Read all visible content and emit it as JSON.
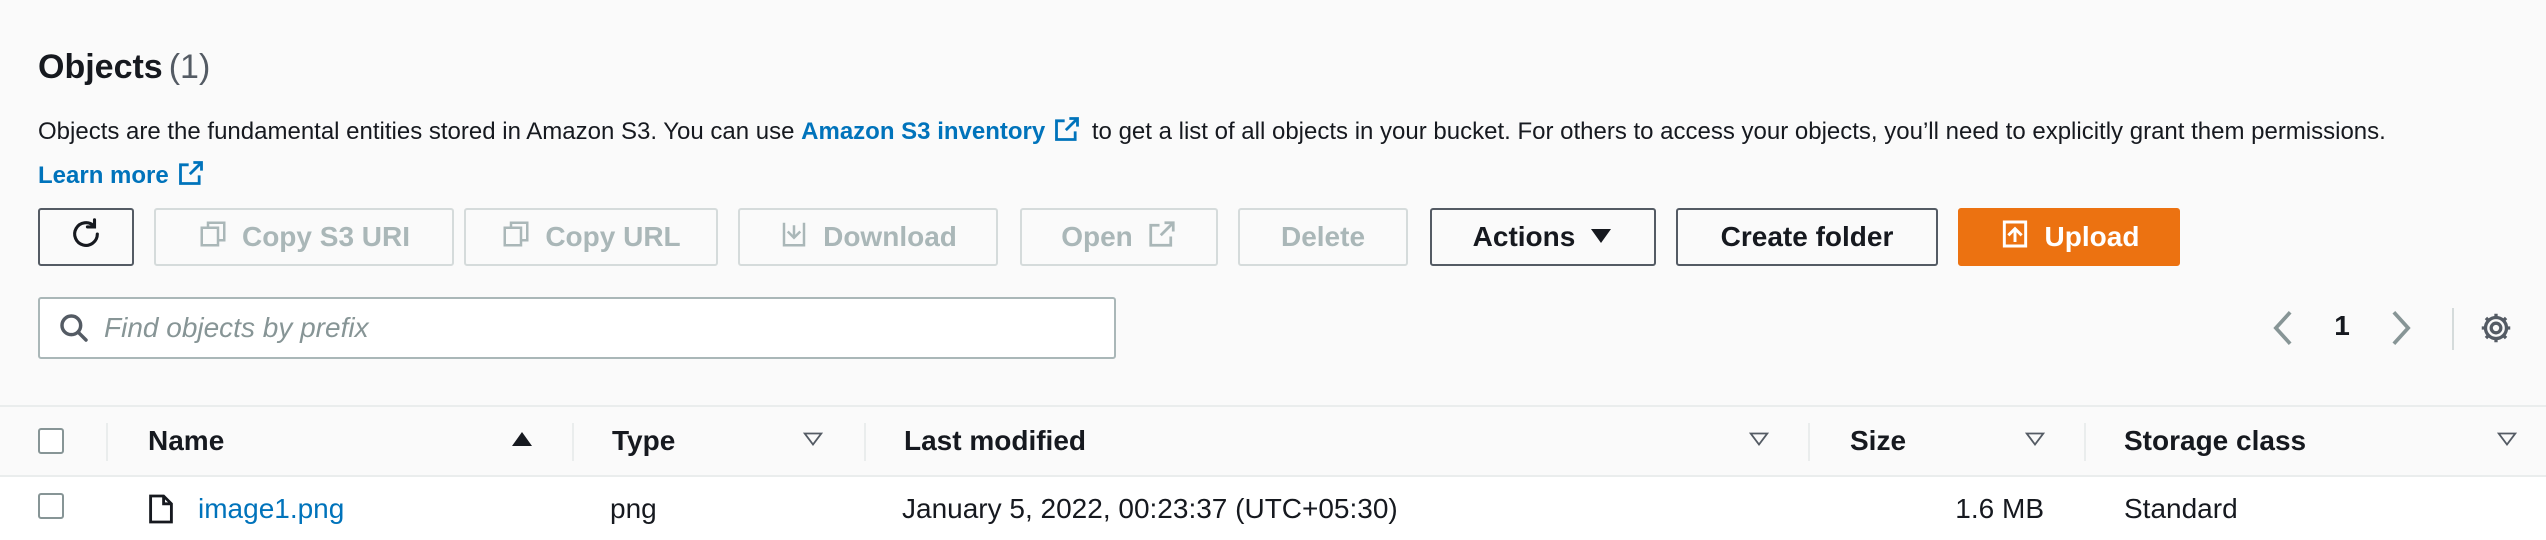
{
  "header": {
    "title": "Objects",
    "count": "(1)"
  },
  "description": {
    "text_before": "Objects are the fundamental entities stored in Amazon S3. You can use ",
    "inventory_link": "Amazon S3 inventory",
    "text_after": " to get a list of all objects in your bucket. For others to access your objects, you’ll need to explicitly grant them permissions.",
    "learn_more": "Learn more"
  },
  "toolbar": {
    "copy_s3_uri": "Copy S3 URI",
    "copy_url": "Copy URL",
    "download": "Download",
    "open": "Open",
    "delete": "Delete",
    "actions": "Actions",
    "create_folder": "Create folder",
    "upload": "Upload"
  },
  "search": {
    "placeholder": "Find objects by prefix",
    "value": ""
  },
  "pagination": {
    "current_page": "1"
  },
  "table": {
    "columns": {
      "name": "Name",
      "type": "Type",
      "last_modified": "Last modified",
      "size": "Size",
      "storage_class": "Storage class"
    },
    "rows": [
      {
        "name": "image1.png",
        "type": "png",
        "last_modified": "January 5, 2022, 00:23:37 (UTC+05:30)",
        "size": "1.6 MB",
        "storage_class": "Standard"
      }
    ]
  },
  "colors": {
    "link": "#0073bb",
    "primary": "#ec7211",
    "text": "#16191f",
    "disabled": "#aab7b8"
  }
}
